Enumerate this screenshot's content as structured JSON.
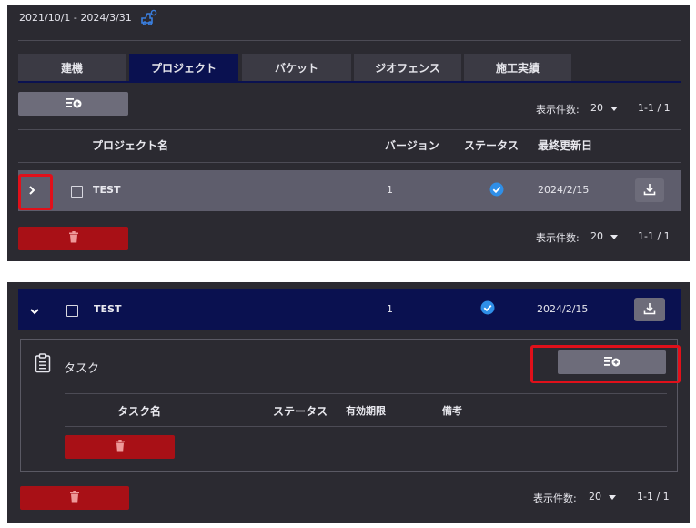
{
  "top": {
    "date_range": "2021/10/1 - 2024/3/31",
    "tabs": [
      {
        "label": "建機"
      },
      {
        "label": "プロジェクト"
      },
      {
        "label": "バケット"
      },
      {
        "label": "ジオフェンス"
      },
      {
        "label": "施工実績"
      }
    ],
    "active_tab": "プロジェクト",
    "pagination": {
      "label": "表示件数:",
      "page_size": "20",
      "range": "1-1 / 1"
    },
    "columns": {
      "name": "プロジェクト名",
      "version": "バージョン",
      "status": "ステータス",
      "updated": "最終更新日"
    },
    "row": {
      "name": "TEST",
      "version": "1",
      "updated": "2024/2/15"
    },
    "pagination_bottom": {
      "label": "表示件数:",
      "page_size": "20",
      "range": "1-1 / 1"
    }
  },
  "bottom": {
    "row": {
      "name": "TEST",
      "version": "1",
      "updated": "2024/2/15"
    },
    "task_section": {
      "title": "タスク",
      "columns": {
        "name": "タスク名",
        "status": "ステータス",
        "expiry": "有効期限",
        "notes": "備考"
      }
    },
    "pagination": {
      "label": "表示件数:",
      "page_size": "20",
      "range": "1-1 / 1"
    }
  },
  "colors": {
    "accent_navy": "#0a1150",
    "danger_red": "#a81016",
    "highlight_red": "#e0101a",
    "status_blue": "#2f8fe8"
  },
  "icons": [
    "machine-settings-icon",
    "add-list-icon",
    "chevron-right-icon",
    "chevron-down-icon",
    "check-circle-icon",
    "download-icon",
    "trash-icon",
    "clipboard-icon",
    "caret-down-icon"
  ]
}
